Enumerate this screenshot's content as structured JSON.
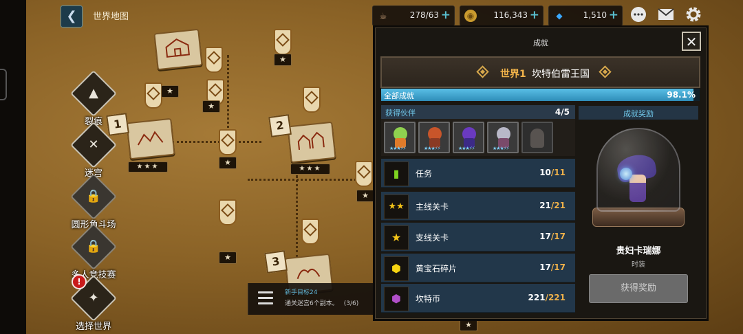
{
  "header": {
    "back_glyph": "❮",
    "title": "世界地图"
  },
  "resources": {
    "stamina": {
      "icon": "coffee-cup-icon",
      "value": "278/63",
      "plus": "+"
    },
    "gold": {
      "icon": "gold-coin-icon",
      "value": "116,343",
      "plus": "+"
    },
    "gems": {
      "icon": "gem-icon",
      "value": "1,510",
      "plus": "+"
    }
  },
  "top_icons": {
    "chat": "chat-icon",
    "mail": "mail-icon",
    "settings": "gear-icon"
  },
  "nav": {
    "rift": {
      "label": "裂痕",
      "glyph": "▲"
    },
    "labyrinth": {
      "label": "迷宫",
      "glyph": "✕"
    },
    "arena": {
      "label": "圆形角斗场",
      "glyph": "🔒"
    },
    "pvp": {
      "label": "多人竞技赛",
      "glyph": "🔒"
    },
    "world_select": {
      "label": "选择世界",
      "glyph": "✦",
      "alert": "!"
    }
  },
  "map": {
    "stages": [
      "1",
      "2",
      "3"
    ],
    "stars3": "★★★",
    "star": "★"
  },
  "quest": {
    "title": "新手目标24",
    "desc": "通关迷宫6个副本。",
    "progress": "(3/6)"
  },
  "panel": {
    "title": "成就",
    "close": "✕",
    "world_num": "世界1",
    "world_name": "坎特伯雷王国",
    "overall_label": "全部成就",
    "overall_pct": "98.1%",
    "overall_fraction": 0.981,
    "partners_label": "获得伙伴",
    "partners_count": "4/5",
    "partner_level": "★★★⚡⚡",
    "rows": [
      {
        "label": "任务",
        "cur": "10",
        "tot": "/11",
        "icon": "bookmark-icon",
        "color": "#7ed321"
      },
      {
        "label": "主线关卡",
        "cur": "21",
        "tot": "/21",
        "icon": "triple-star-icon",
        "color": "#f5c518"
      },
      {
        "label": "支线关卡",
        "cur": "17",
        "tot": "/17",
        "icon": "star-icon",
        "color": "#f5c518"
      },
      {
        "label": "黄宝石碎片",
        "cur": "17",
        "tot": "/17",
        "icon": "gem-shard-icon",
        "color": "#f5d311"
      },
      {
        "label": "坎特币",
        "cur": "221",
        "tot": "/221",
        "icon": "kanter-coin-icon",
        "color": "#b04fc9"
      }
    ],
    "reward_label": "成就奖励",
    "reward_name": "贵妇卡瑞娜",
    "reward_type": "时装",
    "claim_label": "获得奖励"
  }
}
